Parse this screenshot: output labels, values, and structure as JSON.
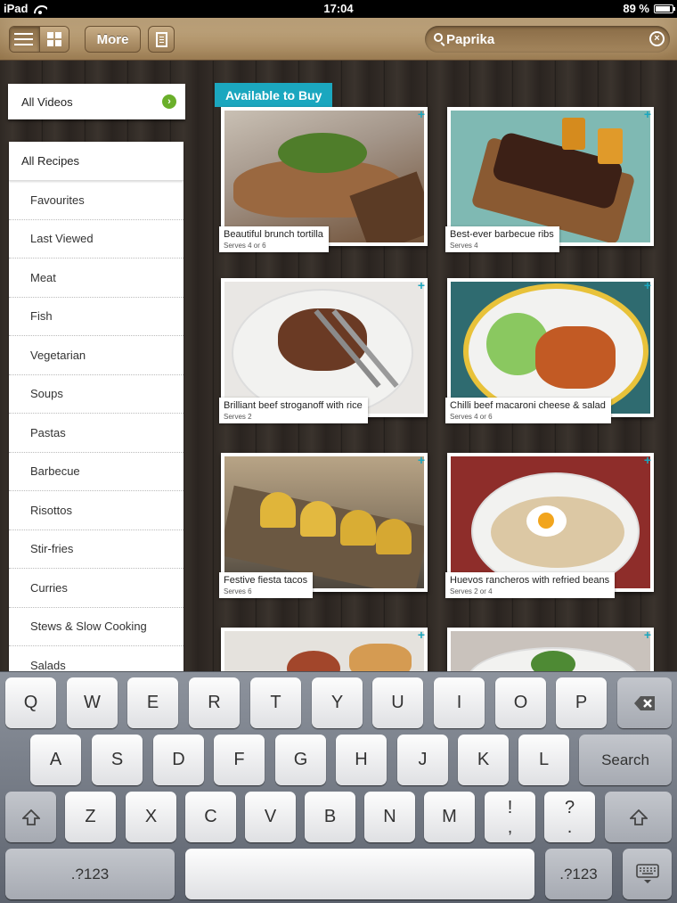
{
  "status_bar": {
    "carrier": "iPad",
    "time": "17:04",
    "battery": "89 %"
  },
  "toolbar": {
    "more_label": "More"
  },
  "search": {
    "value": "Paprika",
    "clear": "×"
  },
  "sidebar": {
    "all_videos": "All Videos",
    "all_recipes": "All Recipes",
    "items": [
      "Favourites",
      "Last Viewed",
      "Meat",
      "Fish",
      "Vegetarian",
      "Soups",
      "Pastas",
      "Barbecue",
      "Risottos",
      "Stir-fries",
      "Curries",
      "Stews & Slow Cooking",
      "Salads"
    ]
  },
  "content": {
    "badge": "Available to Buy",
    "recipes": [
      {
        "title": "Beautiful brunch tortilla",
        "serves": "Serves 4 or 6"
      },
      {
        "title": "Best-ever barbecue ribs",
        "serves": "Serves 4"
      },
      {
        "title": "Brilliant beef stroganoff with rice",
        "serves": "Serves 2"
      },
      {
        "title": "Chilli beef macaroni cheese & salad",
        "serves": "Serves 4 or 6"
      },
      {
        "title": "Festive fiesta tacos",
        "serves": "Serves 6"
      },
      {
        "title": "Huevos rancheros with refried beans",
        "serves": "Serves 2 or 4"
      }
    ]
  },
  "keyboard": {
    "row1": [
      "Q",
      "W",
      "E",
      "R",
      "T",
      "Y",
      "U",
      "I",
      "O",
      "P"
    ],
    "row2": [
      "A",
      "S",
      "D",
      "F",
      "G",
      "H",
      "J",
      "K",
      "L"
    ],
    "row3": [
      "Z",
      "X",
      "C",
      "V",
      "B",
      "N",
      "M"
    ],
    "exclaim_top": "!",
    "exclaim_bottom": ",",
    "question_top": "?",
    "question_bottom": ".",
    "search_label": "Search",
    "numbers_label": ".?123"
  }
}
